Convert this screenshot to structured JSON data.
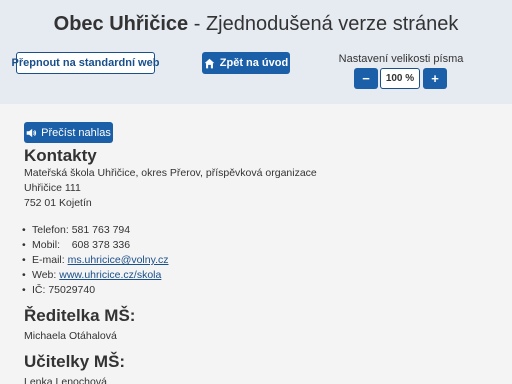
{
  "header": {
    "title_bold": "Obec Uhřičice",
    "title_rest": " - Zjednodušená verze stránek",
    "standard_web_label": "Přepnout na standardní web",
    "home_label": "Zpět na úvod",
    "font_size": {
      "label": "Nastavení velikosti písma",
      "minus": "−",
      "value": "100 %",
      "plus": "+"
    }
  },
  "read_aloud_label": "Přečíst nahlas",
  "contacts": {
    "heading": "Kontakty",
    "org": "Mateřská škola Uhřičice, okres Přerov, příspěvková organizace",
    "street": "Uhřičice 111",
    "city": "752 01 Kojetín",
    "items": [
      {
        "label": "Telefon: ",
        "value": "581 763 794"
      },
      {
        "label": "Mobil: ",
        "value": "608 378 336"
      },
      {
        "label": "E-mail: ",
        "value": "ms.uhricice@volny.cz",
        "link": true
      },
      {
        "label": "Web: ",
        "value": "www.uhricice.cz/skola",
        "link": true
      },
      {
        "label": "IČ: ",
        "value": "75029740"
      }
    ]
  },
  "director": {
    "heading": "Ředitelka MŠ:",
    "name": "Michaela Otáhalová"
  },
  "teachers": {
    "heading": "Učitelky MŠ:",
    "name": "Lenka Lenochová"
  },
  "colors": {
    "header_bg": "#e6ebf2",
    "accent": "#1a5fa8",
    "link": "#1a4f8a"
  }
}
